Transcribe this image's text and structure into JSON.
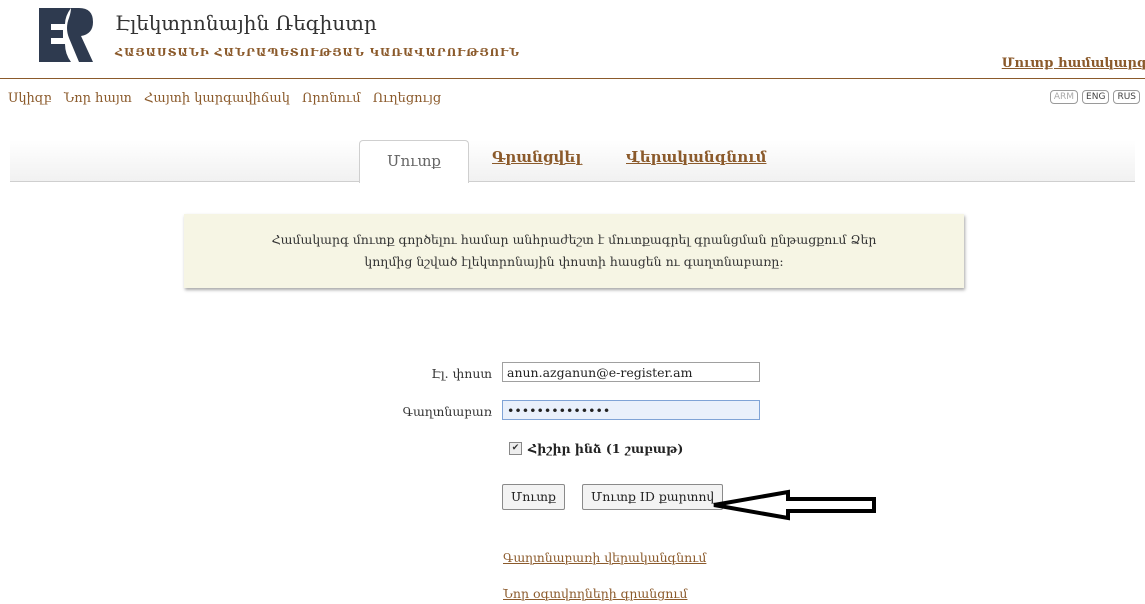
{
  "header": {
    "title": "Էլեկտրոնային Ռեգիստր",
    "subtitle": "ՀԱՅԱՍՏԱՆԻ ՀԱՆՐԱՊԵՏՈՒԹՅԱՆ ԿԱՌԱՎԱՐՈՒԹՅՈՒՆ",
    "login_link": "Մուտք համակարգ"
  },
  "nav": {
    "items": [
      "Սկիզբ",
      "Նոր հայտ",
      "Հայտի կարգավիճակ",
      "Որոնում",
      "Ուղեցույց"
    ]
  },
  "languages": [
    "ARM",
    "ENG",
    "RUS"
  ],
  "tabs": {
    "login": "Մուտք",
    "register": "Գրանցվել",
    "recover": "Վերականգնում"
  },
  "notice": "Համակարգ մուտք գործելու համար անհրաժեշտ է մուտքագրել գրանցման ընթացքում Ձեր կողմից նշված էլեկտրոնային փոստի հասցեն ու գաղտնաբառը:",
  "form": {
    "email_label": "Էլ. փոստ",
    "email_value": "anun.azganun@e-register.am",
    "password_label": "Գաղտնաբառ",
    "password_value": "••••••••••••••",
    "remember_label": "Հիշիր ինձ (1 շաբաթ)",
    "remember_checked": true,
    "login_button": "Մուտք",
    "id_login_button": "Մուտք ID քարտով"
  },
  "links": {
    "password_recovery": "Գաղտնաբառի վերականգնում",
    "new_user_registration": "Նոր օգտվողների գրանցում"
  },
  "colors": {
    "accent": "#8b5a2b",
    "notice_bg": "#f6f5e4",
    "logo": "#2e3a4f"
  }
}
